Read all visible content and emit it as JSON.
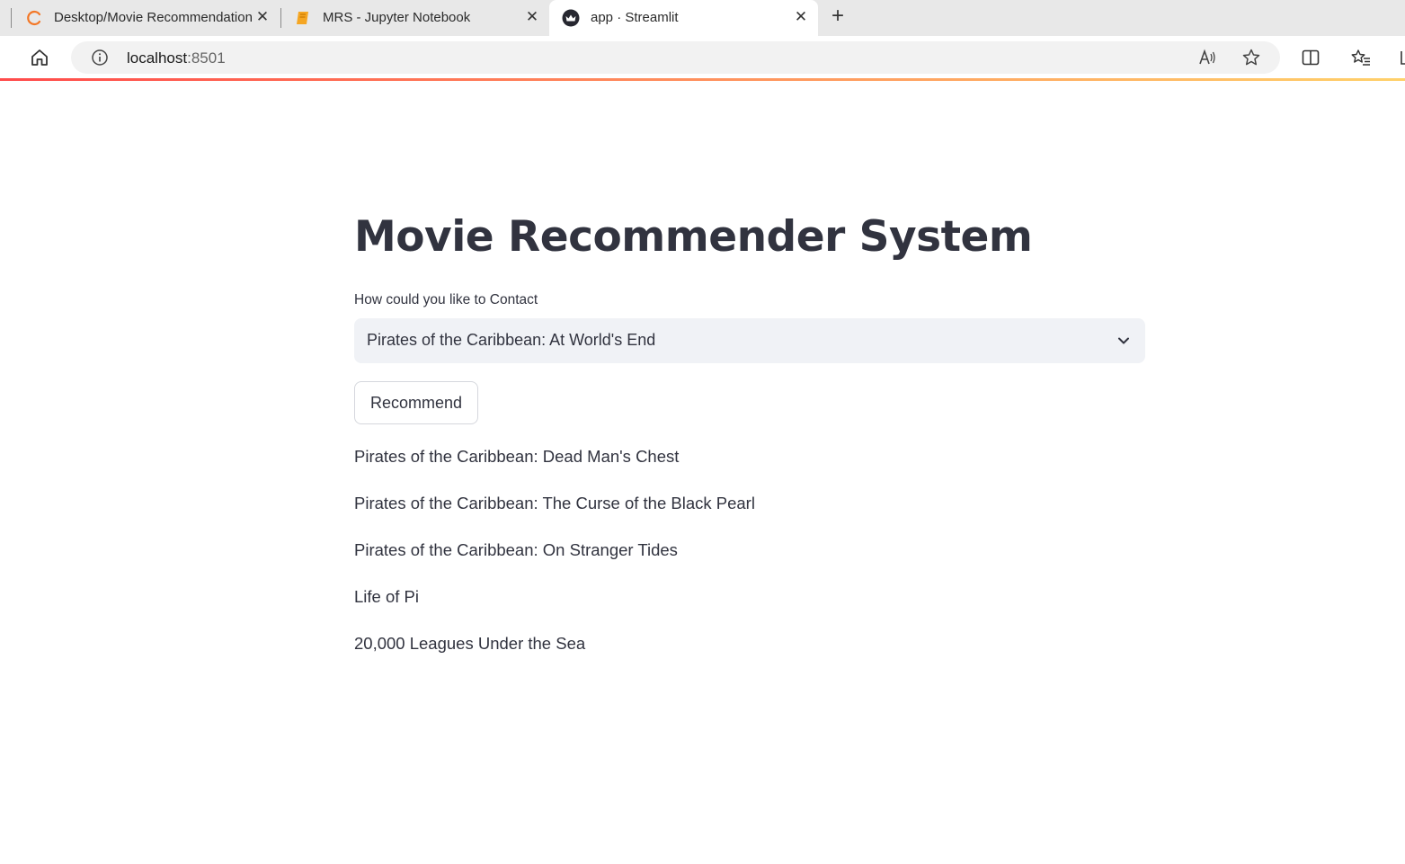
{
  "browser": {
    "tabs": [
      {
        "title": "Desktop/Movie Recommendation",
        "icon": "jupyter-spinner-icon"
      },
      {
        "title": "MRS - Jupyter Notebook",
        "icon": "notebook-icon"
      },
      {
        "title": "app · Streamlit",
        "icon": "streamlit-crown-icon"
      }
    ],
    "url_host": "localhost",
    "url_port": ":8501"
  },
  "app": {
    "title": "Movie Recommender System",
    "select_label": "How could you like to Contact",
    "selected_movie": "Pirates of the Caribbean: At World's End",
    "button_label": "Recommend",
    "recommendations": [
      "Pirates of the Caribbean: Dead Man's Chest",
      "Pirates of the Caribbean: The Curse of the Black Pearl",
      "Pirates of the Caribbean: On Stranger Tides",
      "Life of Pi",
      "20,000 Leagues Under the Sea"
    ]
  },
  "colors": {
    "streamlit_text": "#31333f",
    "select_bg": "#f0f2f6",
    "accent_start": "#ff4b4b",
    "accent_end": "#ffd16a"
  }
}
